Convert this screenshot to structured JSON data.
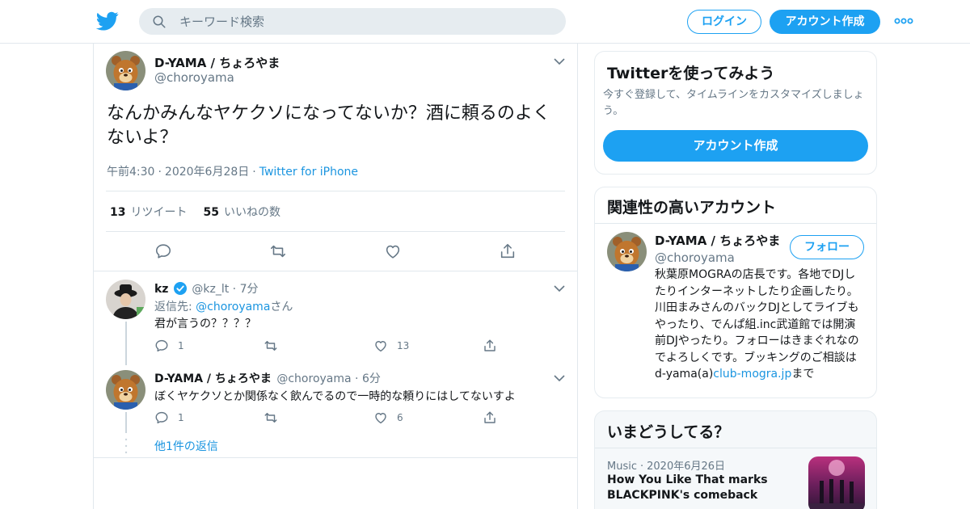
{
  "header": {
    "logo": "twitter-bird-icon",
    "search_placeholder": "キーワード検索",
    "login_label": "ログイン",
    "signup_label": "アカウント作成",
    "more_icon": "more-dots-icon"
  },
  "tweet": {
    "display_name": "D-YAMA / ちょろやま",
    "handle": "@choroyama",
    "text": "なんかみんなヤケクソになってないか？酒に頼るのよくないよ？",
    "time": "午前4:30",
    "date": "2020年6月28日",
    "source": "Twitter for iPhone",
    "retweets_count": "13",
    "retweets_label": "リツイート",
    "likes_count": "55",
    "likes_label": "いいねの数"
  },
  "replies": [
    {
      "display_name": "kz",
      "verified": true,
      "handle": "@kz_lt",
      "age": "7分",
      "reply_to_label": "返信先: ",
      "reply_to_handle": "@choroyama",
      "reply_to_suffix": "さん",
      "text": "君が言うの？？？？",
      "reply_count": "1",
      "retweet_count": "",
      "like_count": "13"
    },
    {
      "display_name": "D-YAMA / ちょろやま",
      "handle": "@choroyama",
      "age": "6分",
      "text": "ぼくヤケクソとか関係なく飲んでるので一時的な頼りにはしてないすよ",
      "reply_count": "1",
      "retweet_count": "",
      "like_count": "6"
    }
  ],
  "more_replies_label": "他1件の返信",
  "sidebar": {
    "signup_card": {
      "title": "Twitterを使ってみよう",
      "description": "今すぐ登録して、タイムラインをカスタマイズしましょう。",
      "button_label": "アカウント作成"
    },
    "related_card": {
      "title": "関連性の高いアカウント",
      "display_name": "D-YAMA / ちょろやま",
      "handle": "@choroyama",
      "follow_label": "フォロー",
      "bio_text": "秋葉原MOGRAの店長です。各地でDJしたりインターネットしたり企画したり。川田まみさんのバックDJとしてライブもやったり、でんぱ組.inc武道館では開演前DJやったり。フォローはきまぐれなのでよろしくです。ブッキングのご相談は d-yama(a)",
      "bio_link": "club-mogra.jp",
      "bio_suffix": "まで"
    },
    "trends_card": {
      "title": "いまどうしてる？",
      "category": "Music",
      "date": "2020年6月26日",
      "headline_line1": "How You Like That marks",
      "headline_line2": "BLACKPINK's comeback"
    }
  },
  "colors": {
    "accent": "#1da1f2",
    "link": "#1b95e0",
    "muted": "#657786",
    "border": "#e1e8ed"
  }
}
